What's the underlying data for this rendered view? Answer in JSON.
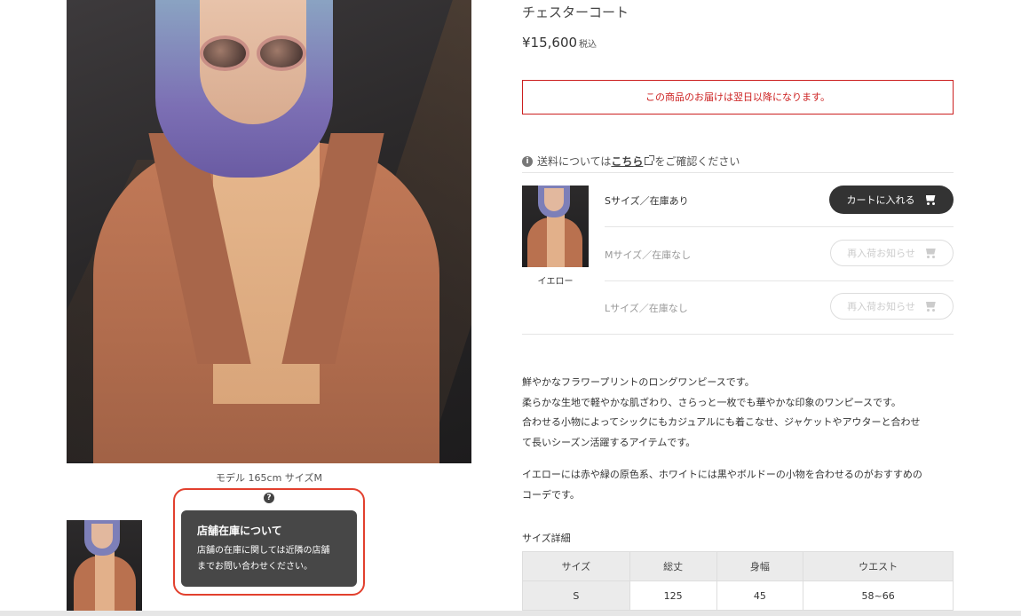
{
  "product": {
    "name": "チェスターコート",
    "price": "¥15,600",
    "tax_label": "税込",
    "delivery_notice": "この商品のお届けは翌日以降になります。"
  },
  "gallery": {
    "main_caption": "モデル 165cm サイズM"
  },
  "store_stock_tooltip": {
    "title": "店舗在庫について",
    "body_line1": "店舗の在庫に関しては近隣の店舗",
    "body_line2": "までお問い合わせください。"
  },
  "shipping": {
    "prefix": "送料については",
    "link_text": "こちら",
    "suffix": "をご確認ください"
  },
  "variants": {
    "color_name": "イエロー",
    "sizes": [
      {
        "label": "Sサイズ／在庫あり",
        "button": "カートに入れる",
        "in_stock": true
      },
      {
        "label": "Mサイズ／在庫なし",
        "button": "再入荷お知らせ",
        "in_stock": false
      },
      {
        "label": "Lサイズ／在庫なし",
        "button": "再入荷お知らせ",
        "in_stock": false
      }
    ]
  },
  "description": {
    "p1_line1": "鮮やかなフラワープリントのロングワンピースです。",
    "p1_line2": "柔らかな生地で軽やかな肌ざわり、さらっと一枚でも華やかな印象のワンピースです。",
    "p1_line3": "合わせる小物によってシックにもカジュアルにも着こなせ、ジャケットやアウターと合わせ",
    "p1_line4": "て長いシーズン活躍するアイテムです。",
    "p2_line1": "イエローには赤や緑の原色系、ホワイトには黒やボルドーの小物を合わせるのがおすすめの",
    "p2_line2": "コーデです。"
  },
  "size_detail": {
    "title": "サイズ詳細",
    "headers": [
      "サイズ",
      "総丈",
      "身幅",
      "ウエスト"
    ],
    "rows": [
      [
        "S",
        "125",
        "45",
        "58~66"
      ]
    ]
  },
  "colors": {
    "notice_red": "#cc1f1f",
    "highlight_red": "#e2402e",
    "dark_button": "#333333",
    "tooltip_bg": "#474747"
  }
}
